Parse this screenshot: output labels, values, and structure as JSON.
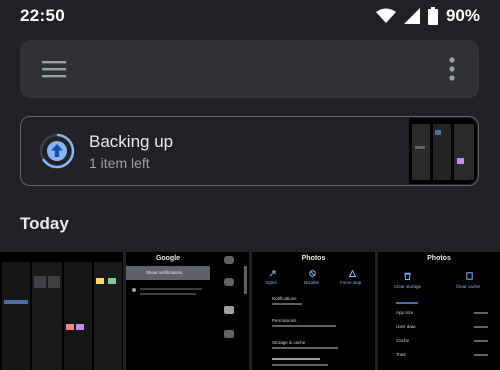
{
  "status_bar": {
    "time": "22:50",
    "battery": "90%"
  },
  "backup": {
    "title": "Backing up",
    "subtitle": "1 item left"
  },
  "section": {
    "title": "Today"
  },
  "tiles": {
    "google": {
      "heading": "Google",
      "notifications": "Show notifications"
    },
    "photos_info": {
      "heading": "Photos",
      "actions": [
        "Open",
        "Disable",
        "Force stop"
      ],
      "notifications": "Notifications",
      "permissions": "Permissions",
      "storage": "Storage & cache"
    },
    "photos_storage": {
      "heading": "Photos",
      "actions": [
        "Clear storage",
        "Clear cache"
      ],
      "rows": [
        "App size",
        "User data",
        "Cache",
        "Total"
      ]
    }
  },
  "icons": {
    "menu": "menu-icon",
    "more": "more-vert-icon",
    "backup": "cloud-upload-icon",
    "wifi": "wifi-icon",
    "signal": "cell-signal-icon",
    "battery": "battery-icon"
  },
  "colors": {
    "background": "#202124",
    "surface": "#303134",
    "accent": "#8ab4f8",
    "accent_dark": "#4a6fa5"
  }
}
